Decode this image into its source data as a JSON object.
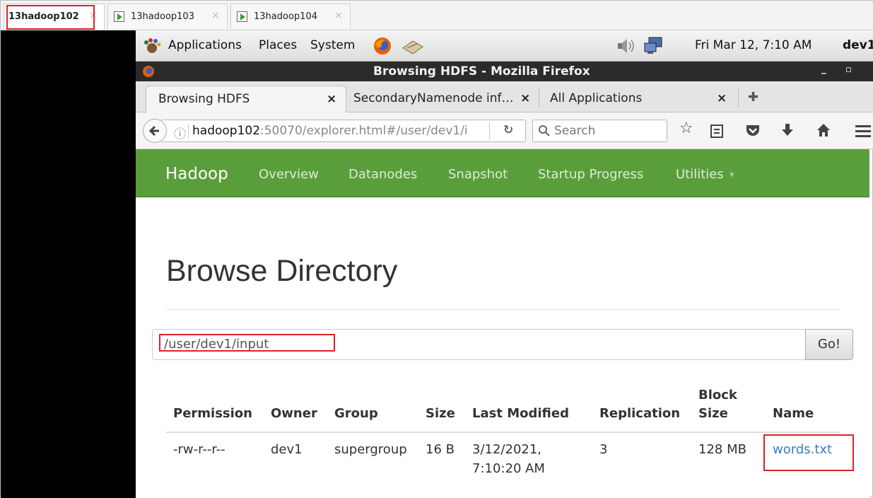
{
  "vm_tabs": [
    {
      "label": "13hadoop102",
      "close": "×"
    },
    {
      "label": "13hadoop103",
      "close": "×"
    },
    {
      "label": "13hadoop104",
      "close": "×"
    }
  ],
  "gnome_panel": {
    "applications": "Applications",
    "places": "Places",
    "system": "System",
    "datetime": "Fri Mar 12,  7:10 AM",
    "user": "dev1"
  },
  "window": {
    "title": "Browsing HDFS - Mozilla Firefox",
    "min": "_",
    "max": "▫",
    "close": "×"
  },
  "browser_tabs": [
    {
      "label": "Browsing HDFS",
      "close": "×"
    },
    {
      "label": "SecondaryNamenode inf…",
      "close": "×"
    },
    {
      "label": "All Applications",
      "close": "×"
    }
  ],
  "new_tab": "✚",
  "url": {
    "host": "hadoop102",
    "rest": ":50070/explorer.html#/user/dev1/i",
    "info": "ⓘ",
    "reload": "↻"
  },
  "search": {
    "placeholder": "Search"
  },
  "hadoop_nav": {
    "brand": "Hadoop",
    "items": [
      "Overview",
      "Datanodes",
      "Snapshot",
      "Startup Progress",
      "Utilities"
    ],
    "caret": "▾"
  },
  "page": {
    "title": "Browse Directory",
    "dir_value": "/user/dev1/input",
    "go_label": "Go!"
  },
  "table": {
    "headers": [
      "Permission",
      "Owner",
      "Group",
      "Size",
      "Last Modified",
      "Replication",
      "Block",
      "Size",
      "Name"
    ],
    "rows": [
      {
        "permission": "-rw-r--r--",
        "owner": "dev1",
        "group": "supergroup",
        "size": "16 B",
        "modified_date": "3/12/2021,",
        "modified_time": "7:10:20 AM",
        "replication": "3",
        "block_size": "128 MB",
        "name": "words.txt"
      }
    ]
  },
  "colors": {
    "hadoop_green": "#5a9e3c",
    "highlight_red": "#e0202a",
    "link_blue": "#3a7bc8"
  }
}
